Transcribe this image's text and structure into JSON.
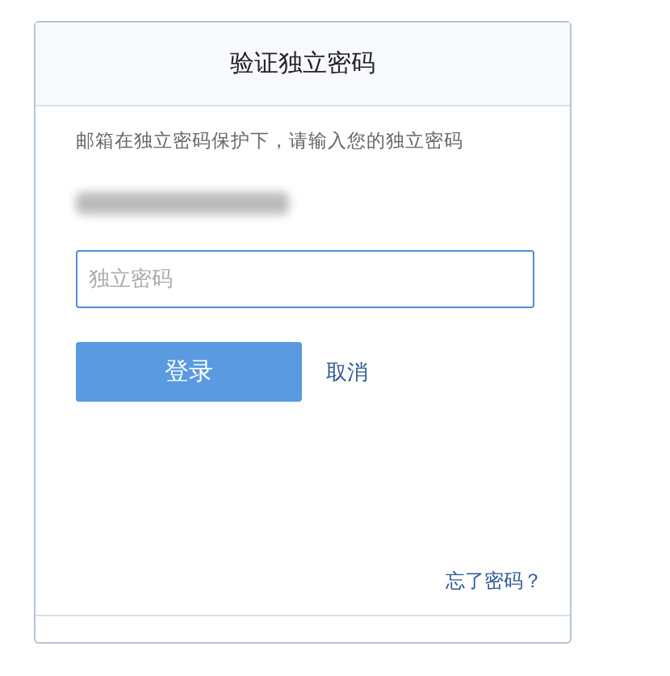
{
  "dialog": {
    "title": "验证独立密码",
    "description": "邮箱在独立密码保护下，请输入您的独立密码",
    "password_field": {
      "placeholder": "独立密码",
      "focused": true
    },
    "login_button": "登录",
    "cancel_link": "取消",
    "forgot_link": "忘了密码？"
  }
}
